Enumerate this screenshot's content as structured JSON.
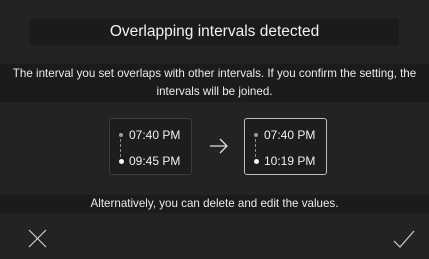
{
  "dialog": {
    "title": "Overlapping intervals detected",
    "message": "The interval you set overlaps with other intervals. If you confirm the setting, the intervals will be joined.",
    "alternative": "Alternatively, you can delete and edit the values."
  },
  "current_interval": {
    "start": "07:40 PM",
    "end": "09:45 PM"
  },
  "joined_interval": {
    "start": "07:40 PM",
    "end": "10:19 PM"
  },
  "icons": {
    "arrow": "arrow-right-icon",
    "cancel": "close-icon",
    "confirm": "checkmark-icon"
  },
  "colors": {
    "background": "#232323",
    "panel": "#1b1b1b",
    "accent": "#ffffff"
  }
}
